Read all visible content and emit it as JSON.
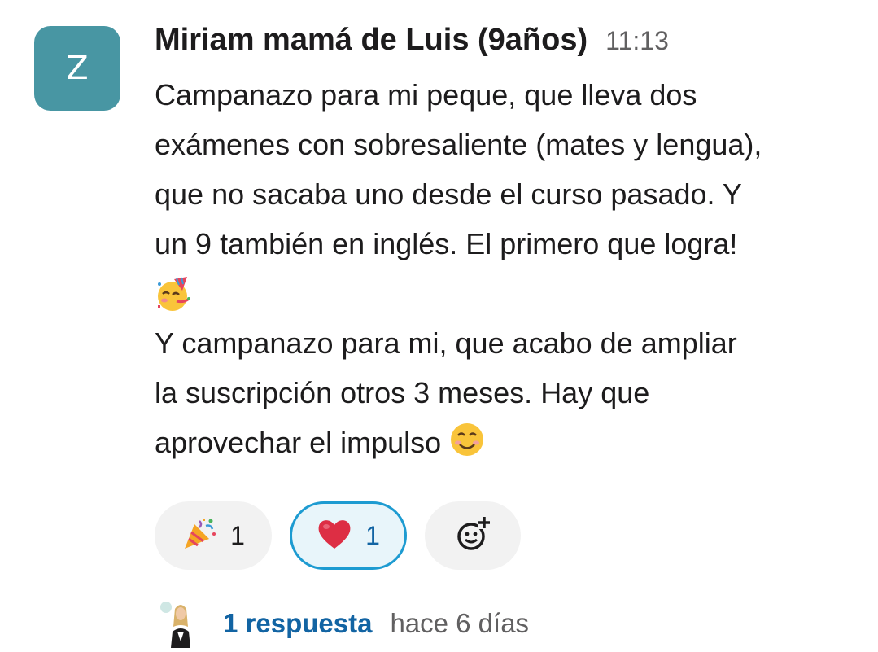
{
  "message": {
    "avatar_initial": "Z",
    "sender": "Miriam mamá de Luis (9años)",
    "time": "11:13",
    "paragraph1": "Campanazo para mi peque, que lleva dos\nexámenes con sobresaliente (mates y lengua),\nque no sacaba uno desde el curso pasado. Y\nun 9 también en inglés. El primero que logra!",
    "paragraph2": "Y campanazo para mi, que acabo de ampliar\nla suscripción otros 3 meses. Hay que\naprovechar el impulso",
    "emojis": {
      "after_paragraph1": "partying-face-icon",
      "after_paragraph2": "smiling-face-icon"
    }
  },
  "reactions": [
    {
      "icon": "party-popper-icon",
      "count": "1",
      "selected": false
    },
    {
      "icon": "heart-icon",
      "count": "1",
      "selected": true
    }
  ],
  "add_reaction": {
    "icon": "add-reaction-icon"
  },
  "thread": {
    "replies": "1 respuesta",
    "last_reply": "hace 6 días"
  },
  "colors": {
    "avatar_bg": "#4896a3",
    "link": "#1264a3",
    "selected_border": "#1d9bd1",
    "selected_bg": "#e8f5fa"
  }
}
